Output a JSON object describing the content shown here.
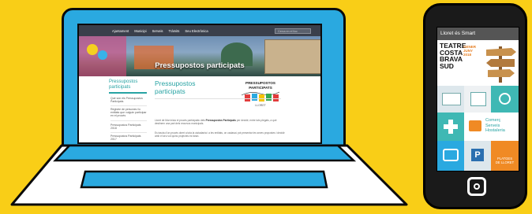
{
  "laptop": {
    "nav": {
      "links": [
        "Ajuntament",
        "Municipi",
        "Serveis",
        "Tràmits",
        "Seu Electrònica"
      ],
      "search_placeholder": "Cerca en el lloc"
    },
    "hero_title": "Pressupostos participats",
    "sidebar": {
      "title": "Pressupostos participats",
      "items": [
        "Què són els Pressupostos Participats",
        "Registre de persones i/o entitats que vulguin participar en el procés",
        "Pressupostos Participats 2018",
        "Pressupostos Participats 2017"
      ]
    },
    "main": {
      "title": "Pressupostos participats",
      "logo_text": [
        "PRESSUPOSTOS",
        "PARTICIPATS",
        "LLORET"
      ],
      "paragraphs": [
        "Lloret de Mar inicia el procés participatiu dels Pressupostos Participats per decidir, entre tots plegats, a què destinem una part dels recursos municipals.",
        "Es tracta d'un procés obert a tota la ciutadania i a les entitats, on cadascú pot presentar les seves propostes i decidir amb el seu vot quins projectes es faran."
      ],
      "bold_phrase": "Pressupostos Participats"
    }
  },
  "phone": {
    "app_title": "Lloret és Smart",
    "tiles": {
      "teatre": [
        "TEATRE",
        "COSTA",
        "BRAVA",
        "SUD"
      ],
      "teatre_date": [
        "GENER",
        "JUNY",
        "2018"
      ],
      "comerc": [
        "Comerç",
        "Serveis",
        "Hostaleria"
      ],
      "platges": [
        "PLATGES",
        "DE LLORET"
      ]
    }
  },
  "colors": {
    "background": "#f9ce17",
    "laptop_frame": "#2aa9e0",
    "teal": "#27a3a3",
    "teal_tile": "#3fb8b4",
    "orange_tile": "#f08a24"
  }
}
